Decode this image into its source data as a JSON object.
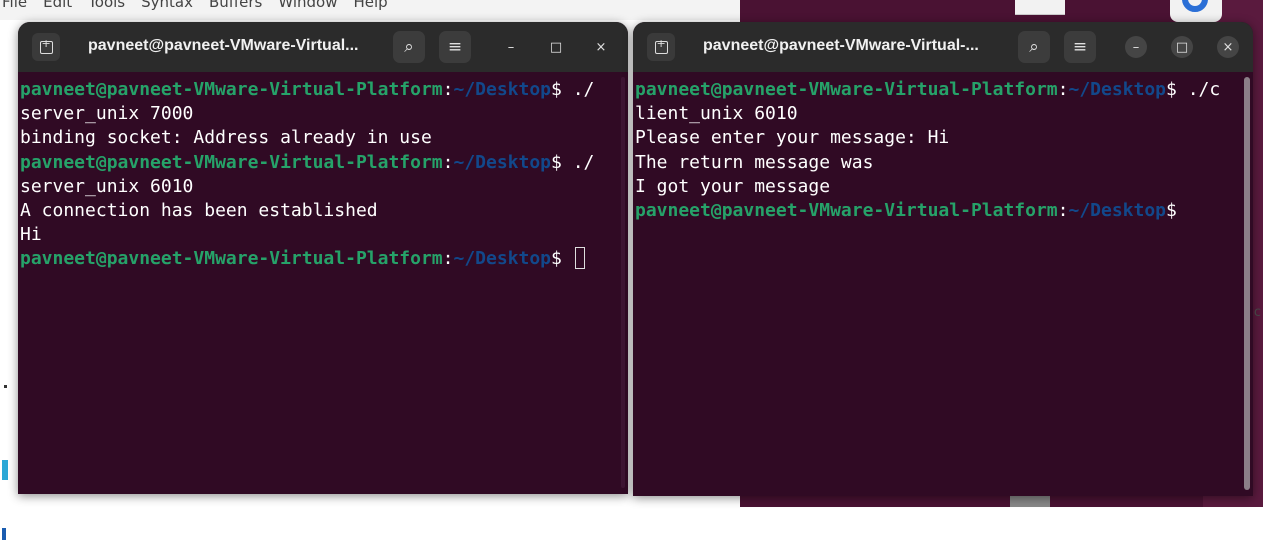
{
  "background_editor": {
    "menu": [
      "File",
      "Edit",
      "Tools",
      "Syntax",
      "Buffers",
      "Window",
      "Help"
    ]
  },
  "terminal_left": {
    "title": "pavneet@pavneet-VMware-Virtual...",
    "buttons": {
      "new_tab": "⊞",
      "search": "⌕",
      "menu": "≡",
      "minimize": "–",
      "maximize": "□",
      "close": "×"
    },
    "prompt": {
      "user": "pavneet@pavneet-VMware-Virtual-Platform",
      "path": "~/Desktop",
      "sep": ":",
      "symbol": "$"
    },
    "lines": [
      {
        "type": "prompt",
        "cmd": " ./"
      },
      {
        "type": "text",
        "text": "server_unix 7000"
      },
      {
        "type": "text",
        "text": "binding socket: Address already in use"
      },
      {
        "type": "prompt",
        "cmd": " ./"
      },
      {
        "type": "text",
        "text": "server_unix 6010"
      },
      {
        "type": "text",
        "text": "A connection has been established"
      },
      {
        "type": "text",
        "text": "Hi"
      },
      {
        "type": "prompt",
        "cmd": " ",
        "cursor": true
      }
    ]
  },
  "terminal_right": {
    "title": "pavneet@pavneet-VMware-Virtual-...",
    "buttons": {
      "new_tab": "⊞",
      "search": "⌕",
      "menu": "≡",
      "minimize": "–",
      "maximize": "□",
      "close": "×"
    },
    "prompt": {
      "user": "pavneet@pavneet-VMware-Virtual-Platform",
      "path": "~/Desktop",
      "sep": ":",
      "symbol": "$"
    },
    "lines": [
      {
        "type": "prompt",
        "cmd": " ./c"
      },
      {
        "type": "text",
        "text": "lient_unix 6010"
      },
      {
        "type": "text",
        "text": "Please enter your message: Hi"
      },
      {
        "type": "text",
        "text": "The return message was"
      },
      {
        "type": "text",
        "text": "I got your message"
      },
      {
        "type": "prompt",
        "cmd": ""
      }
    ]
  },
  "colors": {
    "terminal_bg": "#300a24",
    "titlebar_bg": "#2b2b2b",
    "prompt_user": "#26a269",
    "prompt_path": "#12488b"
  }
}
